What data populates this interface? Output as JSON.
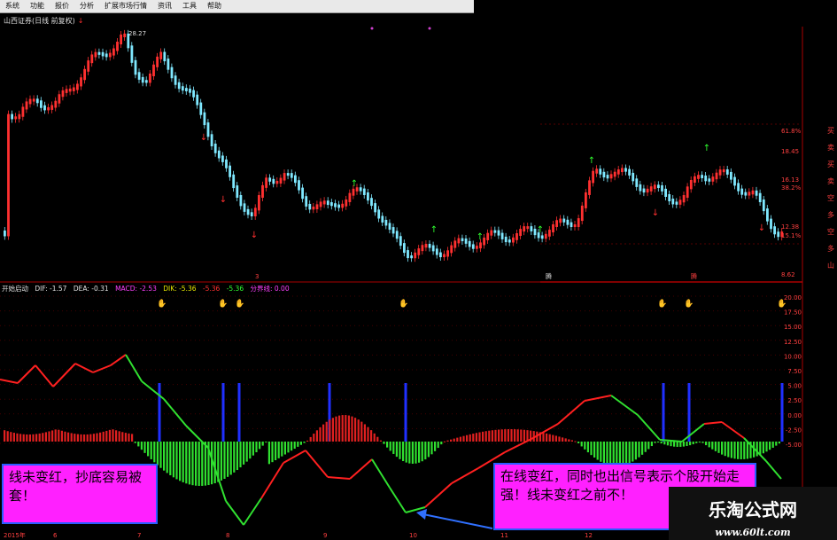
{
  "menu": [
    "系统",
    "功能",
    "报价",
    "分析",
    "扩展市场行情",
    "资讯",
    "工具",
    "帮助"
  ],
  "title": "山西证券(日线 前复权)",
  "price_peak": "28.27",
  "indicator": {
    "name": "开始启动",
    "dif": "DIF: -1.57",
    "dea": "DEA: -0.31",
    "macd": "MACD: -2.53",
    "dik": "DIK: -5.36",
    "v1": "-5.36",
    "v2": "-5.36",
    "v3": "分界线: 0.00"
  },
  "price_axis": [
    "61.8%",
    "18.45",
    "16.13",
    "38.2%",
    "12.38",
    "15.1%",
    "8.62"
  ],
  "macd_axis": [
    "20.00",
    "17.50",
    "15.00",
    "12.50",
    "10.00",
    "7.50",
    "5.00",
    "2.50",
    "0.00",
    "-2.50",
    "-5.00"
  ],
  "date_axis": [
    "2015年",
    "6",
    "7",
    "8",
    "9",
    "10",
    "11",
    "12"
  ],
  "right_labels": [
    "买",
    "卖",
    "买",
    "卖",
    "空",
    "多",
    "空",
    "多",
    "山"
  ],
  "bottom_marks": [
    "3",
    "腾",
    "腾"
  ],
  "annotation_left": "线未变红，抄底容易被套！",
  "annotation_right": "在线变红，同时也出信号表示个股开始走强！线未变红之前不！",
  "watermark_title": "乐淘公式网",
  "watermark_url": "www.60lt.com",
  "colors": {
    "up": "#ff3030",
    "down": "#7fe8ff",
    "dif_red": "#ff2020",
    "dif_green": "#30e030",
    "signal_bar": "#2030ff",
    "annotation_bg": "#ff20ff"
  }
}
